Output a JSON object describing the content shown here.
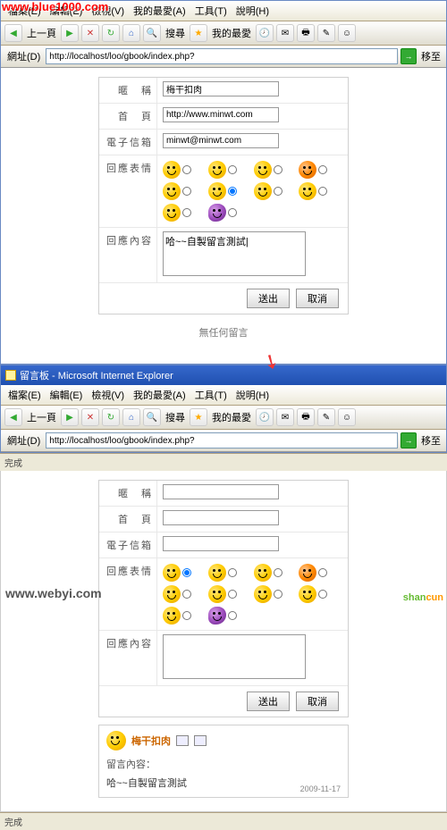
{
  "watermarks": {
    "top": "www.blue1000.com",
    "bottom_left": "www.webyi.com",
    "bottom_right_1": "shan",
    "bottom_right_2": "cun"
  },
  "browser1": {
    "menu": [
      "檔案(E)",
      "編輯(E)",
      "檢視(V)",
      "我的最愛(A)",
      "工具(T)",
      "說明(H)"
    ],
    "back": "上一頁",
    "fav": "我的最愛",
    "search": "搜尋",
    "addr_label": "網址(D)",
    "url": "http://localhost/loo/gbook/index.php?",
    "go": "移至",
    "form": {
      "nickname_label": "暱　稱",
      "nickname": "梅干扣肉",
      "homepage_label": "首　頁",
      "homepage": "http://www.minwt.com",
      "email_label": "電子信箱",
      "email": "minwt@minwt.com",
      "emotion_label": "回應表情",
      "content_label": "回應內容",
      "content": "哈~~自製留言測試|",
      "submit": "送出",
      "cancel": "取消"
    },
    "nomsg": "無任何留言"
  },
  "browser2": {
    "title": "留言板 - Microsoft Internet Explorer",
    "menu": [
      "檔案(E)",
      "編輯(E)",
      "檢視(V)",
      "我的最愛(A)",
      "工具(T)",
      "說明(H)"
    ],
    "back": "上一頁",
    "fav": "我的最愛",
    "search": "搜尋",
    "addr_label": "網址(D)",
    "url": "http://localhost/loo/gbook/index.php?",
    "go": "移至",
    "status": "完成",
    "form": {
      "nickname_label": "暱　稱",
      "nickname": "",
      "homepage_label": "首　頁",
      "homepage": "",
      "email_label": "電子信箱",
      "email": "",
      "emotion_label": "回應表情",
      "content_label": "回應內容",
      "content": "",
      "submit": "送出",
      "cancel": "取消"
    },
    "post": {
      "name": "梅干扣肉",
      "label": "留言內容：",
      "content": "哈~~自製留言測試",
      "date": "2009-11-17"
    }
  },
  "status_outer": "完成"
}
